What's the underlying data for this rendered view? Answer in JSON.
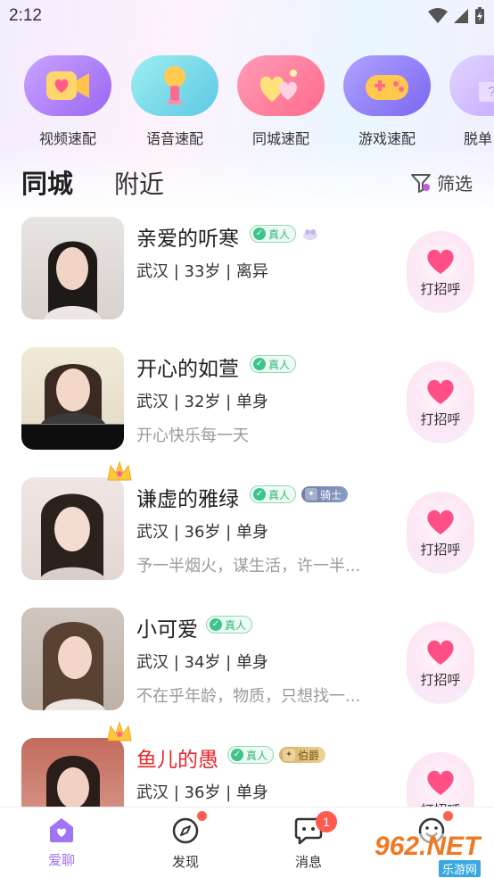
{
  "status_bar": {
    "time": "2:12"
  },
  "quick_match": [
    {
      "label": "视频速配",
      "icon": "video-camera-heart-icon",
      "color_from": "#b98cff",
      "color_to": "#9d6cf7"
    },
    {
      "label": "语音速配",
      "icon": "microphone-icon",
      "color_from": "#86e0e8",
      "color_to": "#5bc9e6"
    },
    {
      "label": "同城速配",
      "icon": "hearts-icon",
      "color_from": "#ff8aa8",
      "color_to": "#ff6b8f"
    },
    {
      "label": "游戏速配",
      "icon": "gamepad-icon",
      "color_from": "#9c8cff",
      "color_to": "#7d6bf3"
    },
    {
      "label": "脱单",
      "icon": "gift-box-icon",
      "color_from": "#d7c4ff",
      "color_to": "#c0a9ff"
    }
  ],
  "tabs": {
    "active": "同城",
    "inactive": "附近"
  },
  "filter": {
    "label": "筛选"
  },
  "users": [
    {
      "name": "亲爱的听寒",
      "real_label": "真人",
      "info": "武汉 | 33岁 | 离异",
      "bio": "",
      "crown": false,
      "name_color": "default",
      "rank": "",
      "gift": true
    },
    {
      "name": "开心的如萱",
      "real_label": "真人",
      "info": "武汉 | 32岁 | 单身",
      "bio": "开心快乐每一天",
      "crown": false,
      "name_color": "default",
      "rank": "",
      "gift": false
    },
    {
      "name": "谦虚的雅绿",
      "real_label": "真人",
      "info": "武汉 | 36岁 | 单身",
      "bio": "予一半烟火，谋生活，许一半...",
      "crown": true,
      "name_color": "default",
      "rank": "骑士",
      "gift": false
    },
    {
      "name": "小可爱",
      "real_label": "真人",
      "info": "武汉 | 34岁 | 单身",
      "bio": "不在乎年龄，物质，只想找一...",
      "crown": false,
      "name_color": "default",
      "rank": "",
      "gift": false
    },
    {
      "name": "鱼儿的愚",
      "real_label": "真人",
      "info": "武汉 | 36岁 | 单身",
      "bio": "",
      "crown": true,
      "name_color": "red",
      "rank": "伯爵",
      "gift": false
    }
  ],
  "greet_label": "打招呼",
  "bottom_nav": {
    "items": [
      {
        "label": "爱聊",
        "active": true
      },
      {
        "label": "发现",
        "active": false
      },
      {
        "label": "消息",
        "active": false,
        "badge": "1"
      },
      {
        "label": "",
        "active": false
      }
    ]
  },
  "watermark": {
    "text": "962.NET",
    "sub": "乐游网"
  },
  "colors": {
    "accent": "#a173f5",
    "heart": "#ff4f86",
    "real_green": "#2fb67a",
    "notice_red": "#ff5b4f"
  }
}
